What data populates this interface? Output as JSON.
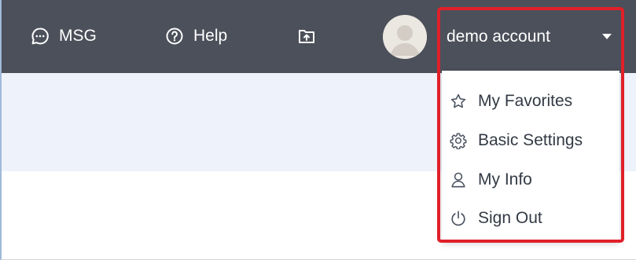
{
  "topbar": {
    "msg": {
      "label": "MSG",
      "icon": "chat-bubble-icon"
    },
    "help": {
      "label": "Help",
      "icon": "help-circle-icon"
    },
    "upload": {
      "icon": "upload-icon"
    },
    "account": {
      "name": "demo account",
      "avatar_icon": "avatar"
    }
  },
  "dropdown": {
    "items": [
      {
        "label": "My Favorites",
        "icon": "star-icon"
      },
      {
        "label": "Basic Settings",
        "icon": "gear-icon"
      },
      {
        "label": "My Info",
        "icon": "user-icon"
      },
      {
        "label": "Sign Out",
        "icon": "power-icon"
      }
    ]
  },
  "colors": {
    "topbar_bg": "#4c505a",
    "band_bg": "#eef2fb",
    "highlight": "#e0202a",
    "menu_text": "#333a44"
  }
}
